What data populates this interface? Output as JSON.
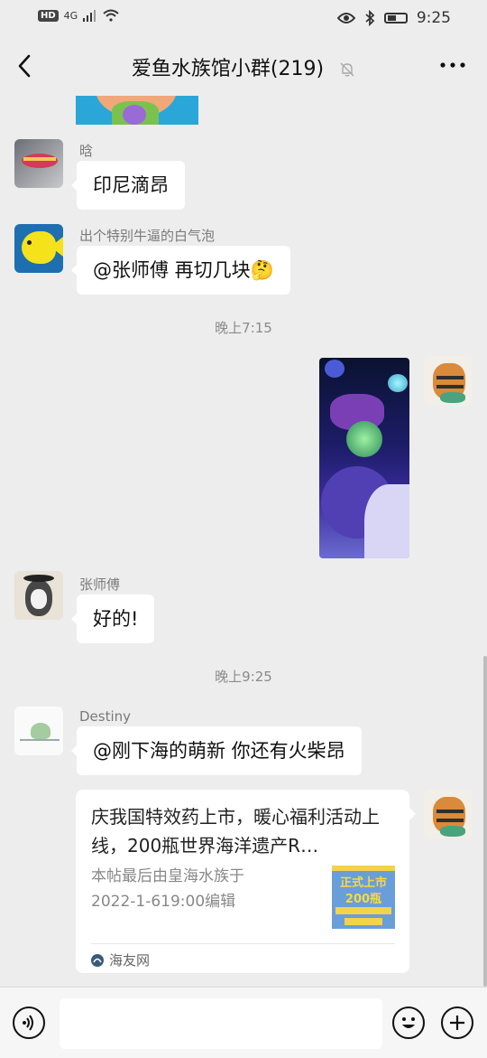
{
  "status_bar": {
    "hd": "HD",
    "network": "4G",
    "time": "9:25"
  },
  "header": {
    "title": "爱鱼水族馆小群(219)"
  },
  "messages": [
    {
      "nickname": "晗",
      "text": "印尼滴昂"
    },
    {
      "nickname": "出个特别牛逼的白气泡",
      "text": "@张师傅  再切几块🤔"
    },
    {
      "nickname": "张师傅",
      "text": "好的!"
    },
    {
      "nickname": "Destiny",
      "text": "@刚下海的萌新  你还有火柴昂"
    }
  ],
  "timestamps": [
    "晚上7:15",
    "晚上9:25"
  ],
  "link_card": {
    "title": "庆我国特效药上市，暖心福利活动上线，200瓶世界海洋遗产R…",
    "desc_line1": "本帖最后由皇海水族于",
    "desc_line2": "2022-1-619:00编辑",
    "thumb_text1": "正式上市",
    "thumb_text2": "200瓶",
    "source": "海友网"
  },
  "icons": {
    "back": "chevron-left-icon",
    "mute": "bell-off-icon",
    "more": "more-dots-icon",
    "voice": "voice-icon",
    "emoji": "emoji-icon",
    "add": "plus-icon"
  }
}
